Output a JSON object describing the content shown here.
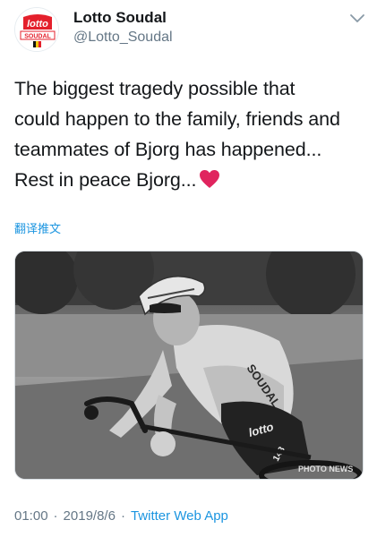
{
  "tweet": {
    "author": {
      "display_name": "Lotto Soudal",
      "handle": "@Lotto_Soudal",
      "avatar_logo_text": "lotto",
      "avatar_logo_subtext": "SOUDAL"
    },
    "text_lines": [
      "The biggest tragedy possible that",
      "could happen to the family, friends and",
      "teammates of Bjorg has happened...",
      "Rest in peace Bjorg..."
    ],
    "translate_label": "翻译推文",
    "media": {
      "jersey_text": "SOUDAL",
      "shorts_text": "lotto",
      "race_number": "143",
      "watermark": "PHOTO NEWS"
    },
    "time": "01:00",
    "separator": "·",
    "date": "2019/8/6",
    "source": "Twitter Web App"
  },
  "colors": {
    "brand_red": "#e4202c",
    "link_blue": "#1b95e0",
    "secondary_text": "#657786",
    "heart_red": "#e0245e"
  },
  "icons": {
    "caret": "chevron-down-icon",
    "heart": "red-heart-emoji"
  }
}
